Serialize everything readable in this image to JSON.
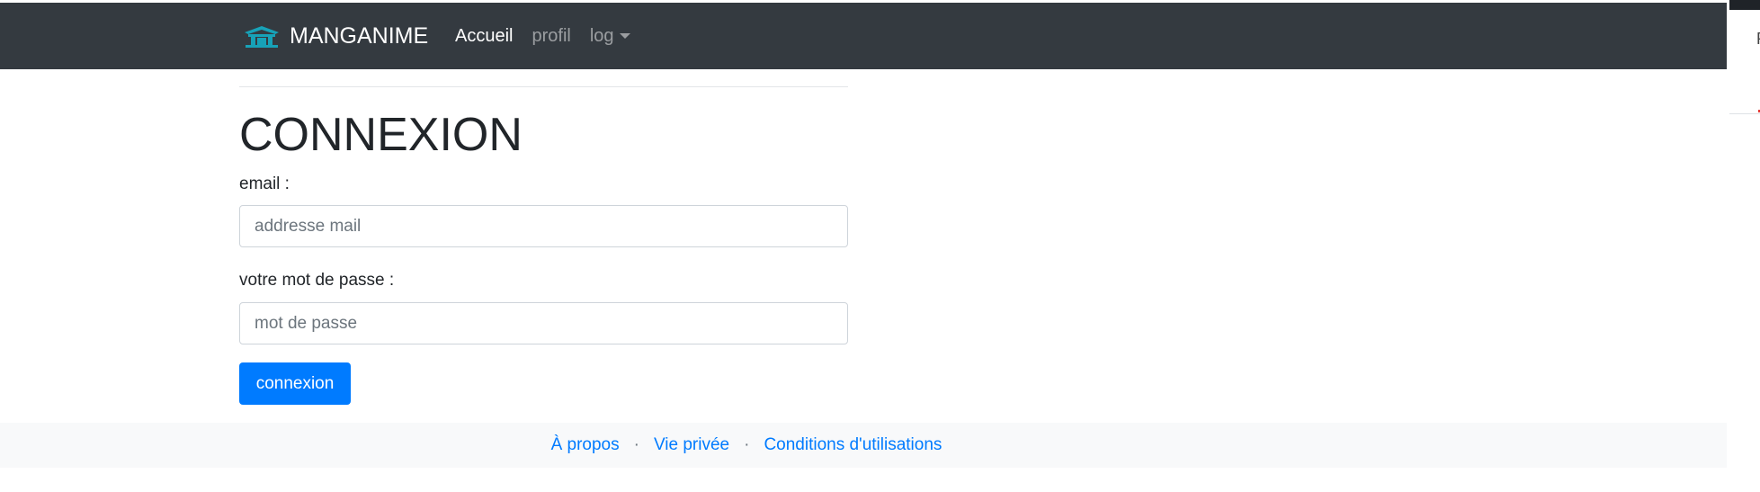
{
  "navbar": {
    "brand": "MANGANIME",
    "links": [
      {
        "label": "Accueil"
      },
      {
        "label": "profil"
      },
      {
        "label": "log"
      }
    ],
    "logo_icon": "house-roof-logo-icon",
    "bg_color": "#343a40",
    "logo_color": "#17a2b8"
  },
  "main": {
    "title": "CONNEXION",
    "email_label": "email :",
    "email_placeholder": "addresse mail",
    "password_label": "votre mot de passe :",
    "password_placeholder": "mot de passe",
    "submit_label": "connexion",
    "accent_color": "#007bff"
  },
  "footer": {
    "links": [
      {
        "label": "À propos"
      },
      {
        "label": "Vie privée"
      },
      {
        "label": "Conditions d'utilisations"
      }
    ],
    "separator": "·"
  }
}
